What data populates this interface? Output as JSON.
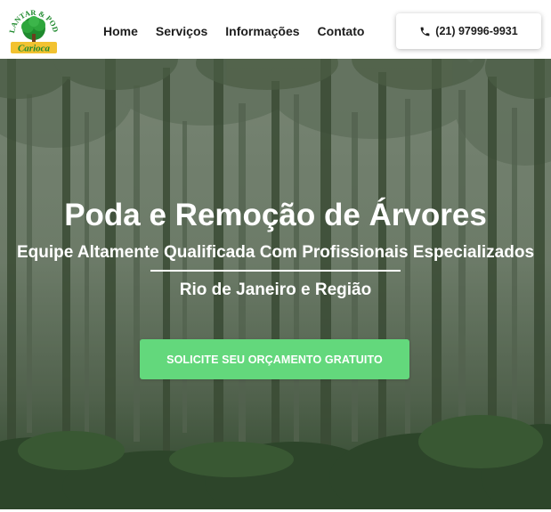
{
  "header": {
    "logo": {
      "arc_text": "PLANTAR & PODA",
      "script_text": "Carioca"
    },
    "nav": [
      {
        "label": "Home"
      },
      {
        "label": "Serviços"
      },
      {
        "label": "Informações"
      },
      {
        "label": "Contato"
      }
    ],
    "phone": {
      "icon": "phone-icon",
      "label": "(21) 97996-9931"
    }
  },
  "hero": {
    "title": "Poda e Remoção de Árvores",
    "subtitle": "Equipe Altamente Qualificada Com Profissionais Especializados",
    "region": "Rio de Janeiro e Região",
    "cta_label": "SOLICITE SEU ORÇAMENTO GRATUITO"
  },
  "colors": {
    "cta": "#63d87c",
    "logo_green": "#1f8a2e",
    "logo_yellow": "#f2c230",
    "text_dark": "#1d1d1d"
  }
}
